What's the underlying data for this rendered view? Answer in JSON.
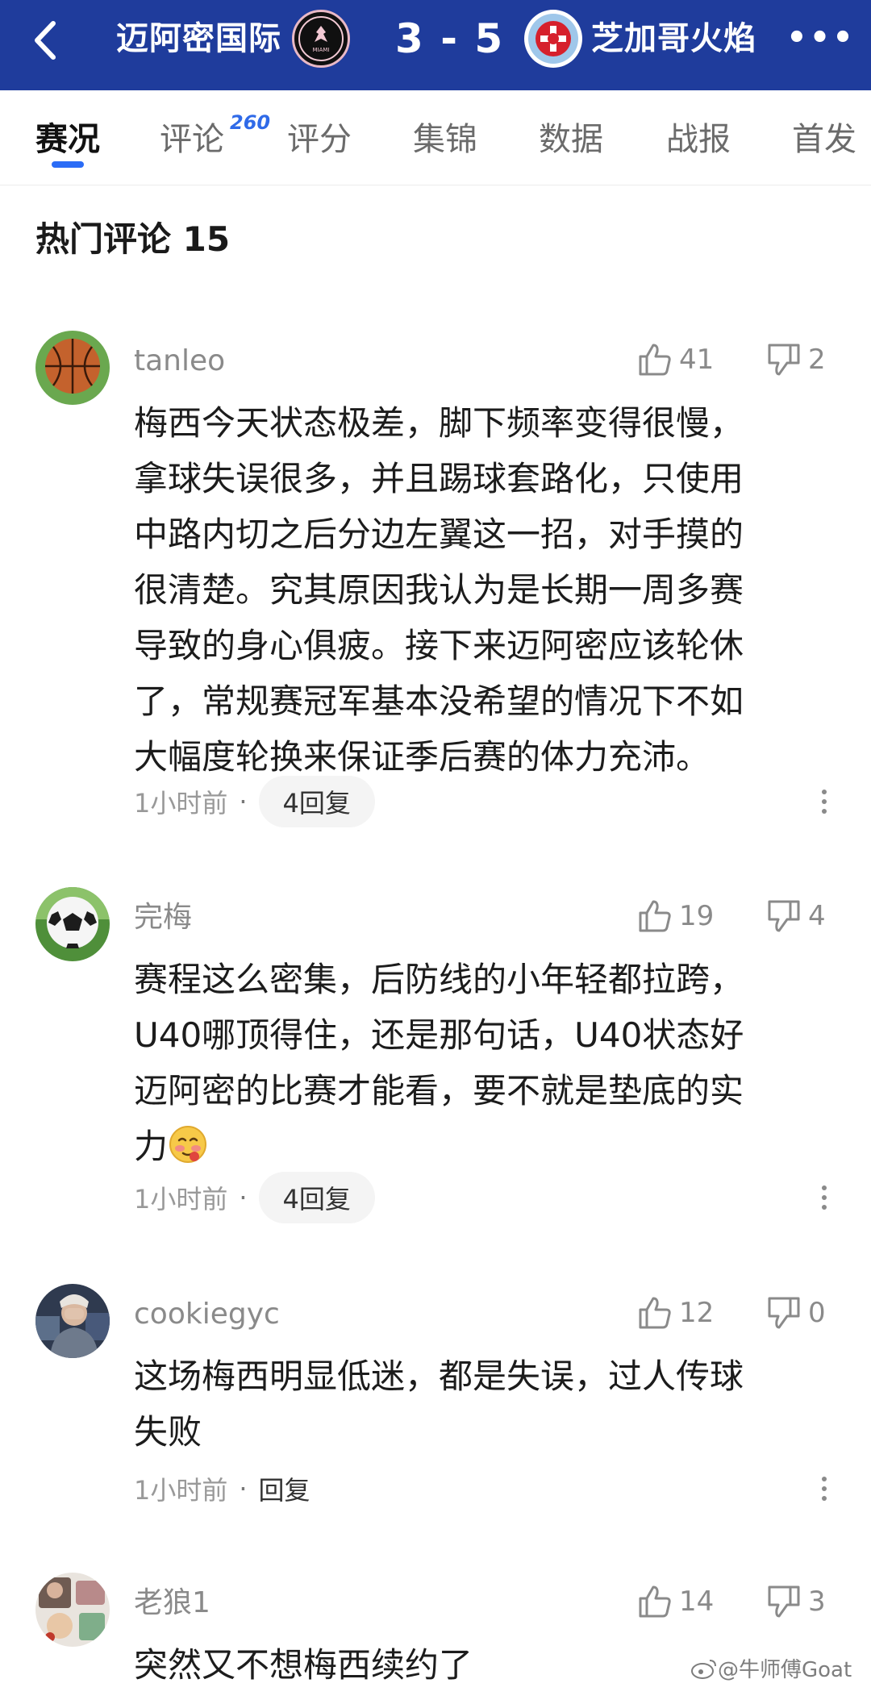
{
  "header": {
    "home_team": "迈阿密国际",
    "score": "3 - 5",
    "away_team": "芝加哥火焰",
    "home_logo_text": "MIAMI",
    "more_label": "•••"
  },
  "tabs": [
    {
      "label": "赛况",
      "active": true
    },
    {
      "label": "评论",
      "badge": "260",
      "active": false
    },
    {
      "label": "评分",
      "active": false
    },
    {
      "label": "集锦",
      "active": false
    },
    {
      "label": "数据",
      "active": false
    },
    {
      "label": "战报",
      "active": false
    },
    {
      "label": "首发",
      "active": false
    }
  ],
  "section": {
    "title": "热门评论 15"
  },
  "comments": [
    {
      "username": "tanleo",
      "avatar": "basketball-avatar",
      "likes": "41",
      "dislikes": "2",
      "text": "梅西今天状态极差，脚下频率变得很慢，\n拿球失误很多，并且踢球套路化，只使用\n中路内切之后分边左翼这一招，对手摸的\n很清楚。究其原因我认为是长期一周多赛\n导致的身心俱疲。接下来迈阿密应该轮休\n了，常规赛冠军基本没希望的情况下不如\n大幅度轮换来保证季后赛的体力充沛。",
      "time": "1小时前",
      "reply": "4回复"
    },
    {
      "username": "完梅",
      "avatar": "soccer-ball-avatar",
      "likes": "19",
      "dislikes": "4",
      "text": "赛程这么密集，后防线的小年轻都拉跨，\nU40哪顶得住，还是那句话，U40状态好\n迈阿密的比赛才能看，要不就是垫底的实\n力",
      "time": "1小时前",
      "reply": "4回复"
    },
    {
      "username": "cookiegyc",
      "avatar": "person-avatar",
      "likes": "12",
      "dislikes": "0",
      "text": "这场梅西明显低迷，都是失误，过人传球\n失败",
      "time": "1小时前",
      "reply": "回复"
    },
    {
      "username": "老狼1",
      "avatar": "photo-avatar",
      "likes": "14",
      "dislikes": "3",
      "text": "突然又不想梅西续约了"
    }
  ],
  "watermark": "@牛师傅Goat",
  "colors": {
    "header_bg": "#1f3c9c",
    "tab_accent": "#2b6cf6",
    "muted_text": "#8a8a8a"
  }
}
